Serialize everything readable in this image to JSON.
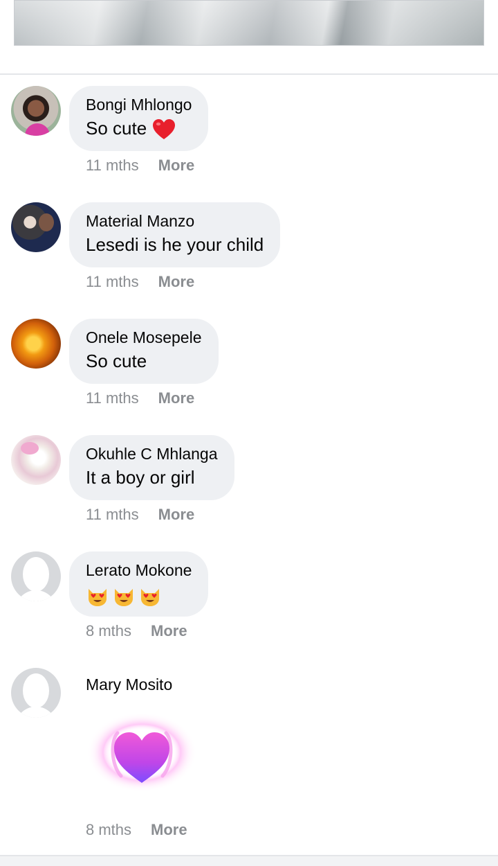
{
  "comments": [
    {
      "author": "Bongi Mhlongo",
      "text": "So cute",
      "emoji": "red-heart",
      "time": "11 mths",
      "more": "More"
    },
    {
      "author": "Material Manzo",
      "text": "Lesedi is he your child",
      "time": "11 mths",
      "more": "More"
    },
    {
      "author": "Onele Mosepele",
      "text": "So cute",
      "time": "11 mths",
      "more": "More"
    },
    {
      "author": "Okuhle C Mhlanga",
      "text": "It a boy or girl",
      "time": "11 mths",
      "more": "More"
    },
    {
      "author": "Lerato Mokone",
      "emoji": "heart-eyes-cat x3",
      "time": "8 mths",
      "more": "More"
    },
    {
      "author": "Mary Mosito",
      "sticker": "pulsing-heart-sticker",
      "time": "8 mths",
      "more": "More"
    }
  ],
  "colors": {
    "bubble": "#eef0f3",
    "meta_text": "#8a8d91",
    "heart_red": "#e81f2c",
    "sticker_pink": "#f05ad8",
    "sticker_purple": "#7c4dff"
  }
}
